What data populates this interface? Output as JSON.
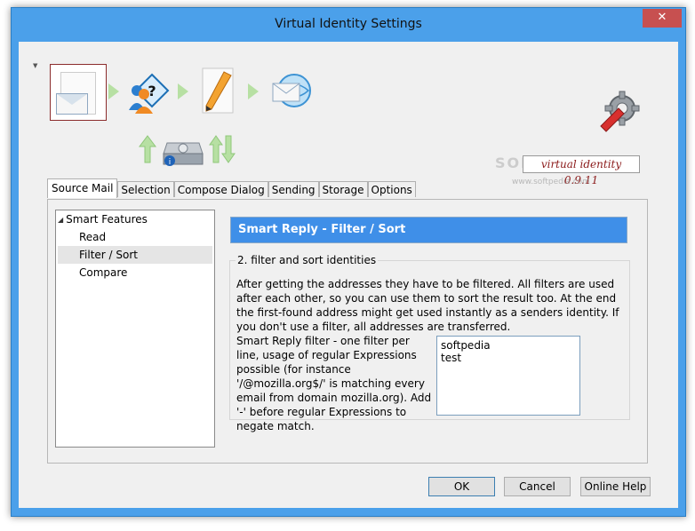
{
  "window": {
    "title": "Virtual Identity Settings",
    "close_glyph": "✕"
  },
  "toolbar": {
    "icons": [
      "mail-document-icon",
      "user-question-icon",
      "pencil-document-icon",
      "globe-mail-icon",
      "hard-drive-icon",
      "settings-gear-icon"
    ],
    "version": "virtual identity 0.9.11",
    "watermark": "SOFTPEDIA",
    "watermark_url": "www.softpedia.com"
  },
  "tabs": [
    {
      "label": "Source Mail",
      "active": true
    },
    {
      "label": "Selection",
      "active": false
    },
    {
      "label": "Compose Dialog",
      "active": false
    },
    {
      "label": "Sending",
      "active": false
    },
    {
      "label": "Storage",
      "active": false
    },
    {
      "label": "Options",
      "active": false
    }
  ],
  "tree": {
    "root": {
      "label": "Smart Features",
      "toggle": "◢"
    },
    "children": [
      {
        "label": "Read",
        "selected": false
      },
      {
        "label": "Filter / Sort",
        "selected": true
      },
      {
        "label": "Compare",
        "selected": false
      }
    ]
  },
  "panel": {
    "header": "Smart Reply - Filter / Sort",
    "group_title": "2. filter and sort identities",
    "description": "After getting the addresses they have to be filtered. All filters are used after each other, so you can use them to sort the result too. At the end the first-found address might get used instantly as a senders identity. If you don't use a filter, all addresses are transferred.",
    "filter_label": "Smart Reply filter - one filter per line, usage of regular Expressions possible (for instance '/@mozilla.org$/' is matching every email from domain mozilla.org). Add '-' before regular Expressions to negate match.",
    "filter_lines": [
      "softpedia",
      "test"
    ]
  },
  "buttons": {
    "ok": "OK",
    "cancel": "Cancel",
    "help": "Online Help"
  },
  "colors": {
    "accent": "#3f8fe8",
    "window_border": "#4ba0ea",
    "version_text": "#8b1a1a",
    "close": "#c75050"
  }
}
